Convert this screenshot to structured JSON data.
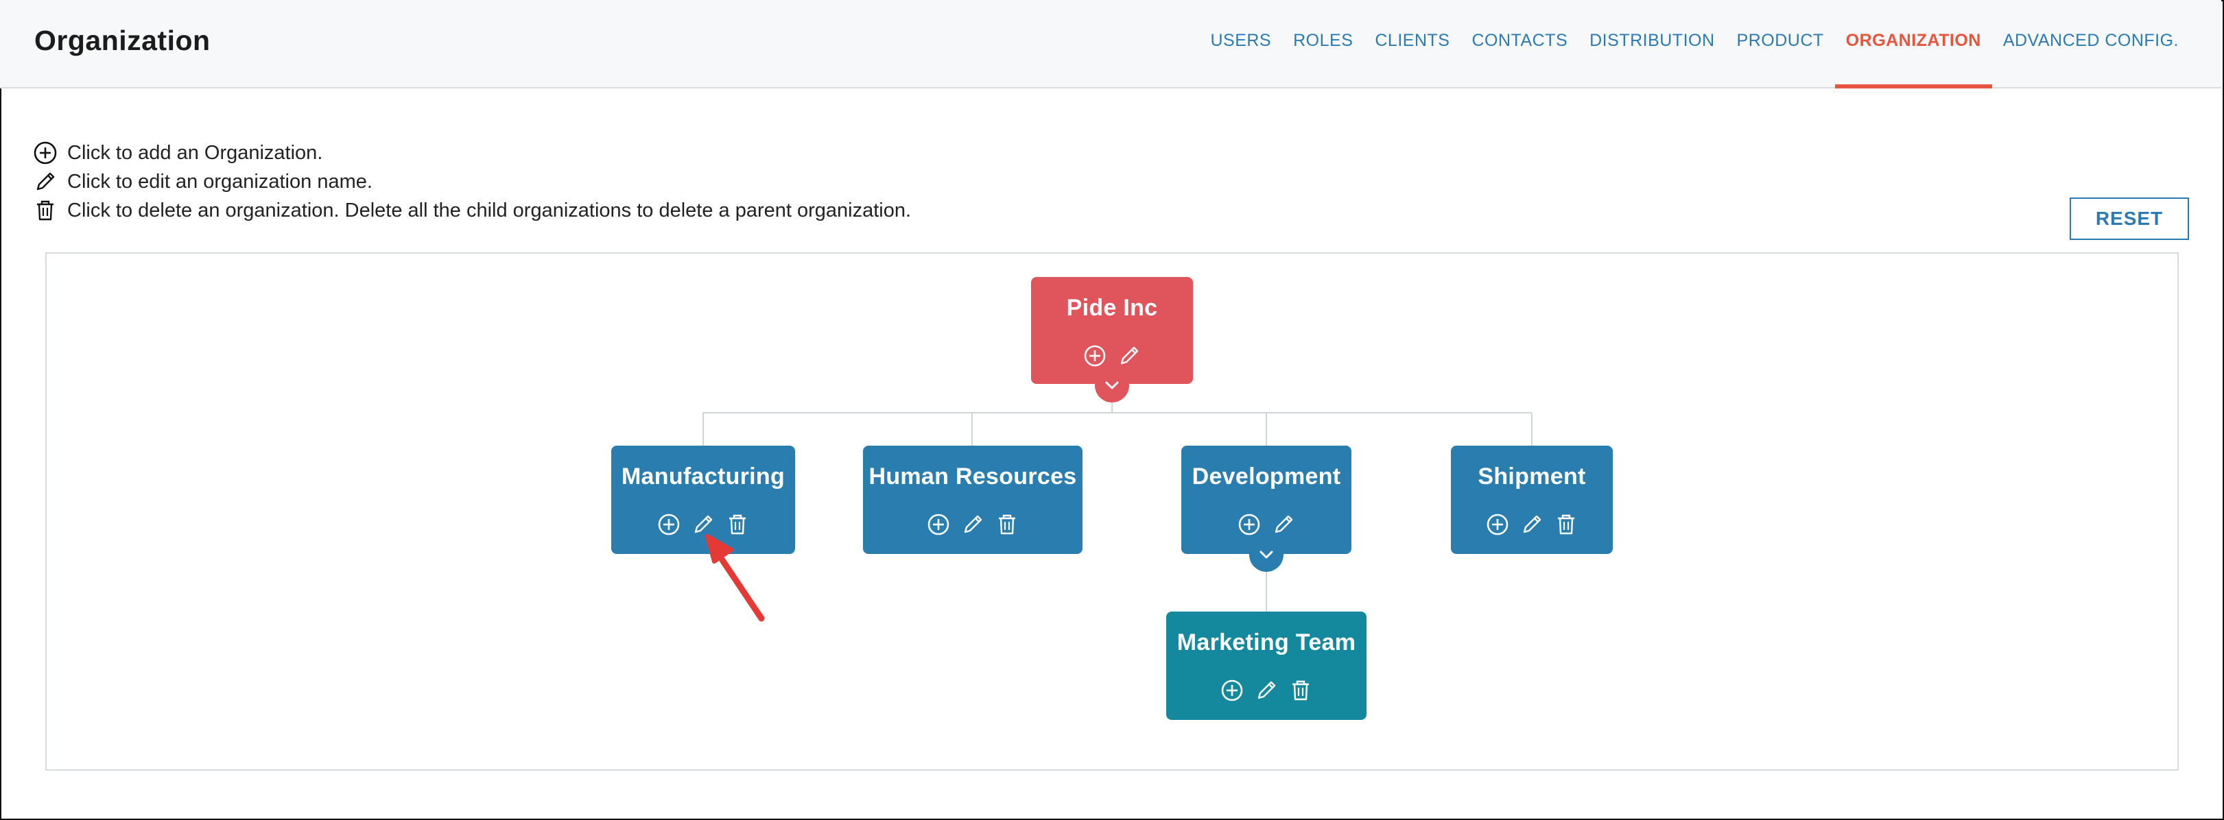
{
  "header": {
    "title": "Organization",
    "tabs": [
      {
        "label": "USERS",
        "active": false
      },
      {
        "label": "ROLES",
        "active": false
      },
      {
        "label": "CLIENTS",
        "active": false
      },
      {
        "label": "CONTACTS",
        "active": false
      },
      {
        "label": "DISTRIBUTION",
        "active": false
      },
      {
        "label": "PRODUCT",
        "active": false
      },
      {
        "label": "ORGANIZATION",
        "active": true
      },
      {
        "label": "ADVANCED CONFIG.",
        "active": false
      }
    ]
  },
  "instructions": {
    "add": {
      "icon": "add-circle-icon",
      "text": "Click to add an Organization."
    },
    "edit": {
      "icon": "pencil-icon",
      "text": "Click to edit an organization name."
    },
    "delete": {
      "icon": "trash-icon",
      "text": "Click to delete an organization. Delete all the child organizations to delete a parent organization."
    }
  },
  "reset_label": "RESET",
  "org_tree": {
    "root": {
      "name": "Pide Inc",
      "color": "#e0555b",
      "actions": [
        "add",
        "edit"
      ]
    },
    "children": [
      {
        "name": "Manufacturing",
        "color": "#2a7daf",
        "actions": [
          "add",
          "edit",
          "delete"
        ]
      },
      {
        "name": "Human Resources",
        "color": "#2a7daf",
        "actions": [
          "add",
          "edit",
          "delete"
        ]
      },
      {
        "name": "Development",
        "color": "#2a7daf",
        "actions": [
          "add",
          "edit"
        ]
      },
      {
        "name": "Shipment",
        "color": "#2a7daf",
        "actions": [
          "add",
          "edit",
          "delete"
        ]
      }
    ],
    "grandchildren": [
      {
        "name": "Marketing Team",
        "parent": "Development",
        "color": "#14899d",
        "actions": [
          "add",
          "edit",
          "delete"
        ]
      }
    ]
  },
  "colors": {
    "accent": "#e8553e",
    "link": "#2b7ab3",
    "annotation_arrow": "#e53935"
  }
}
